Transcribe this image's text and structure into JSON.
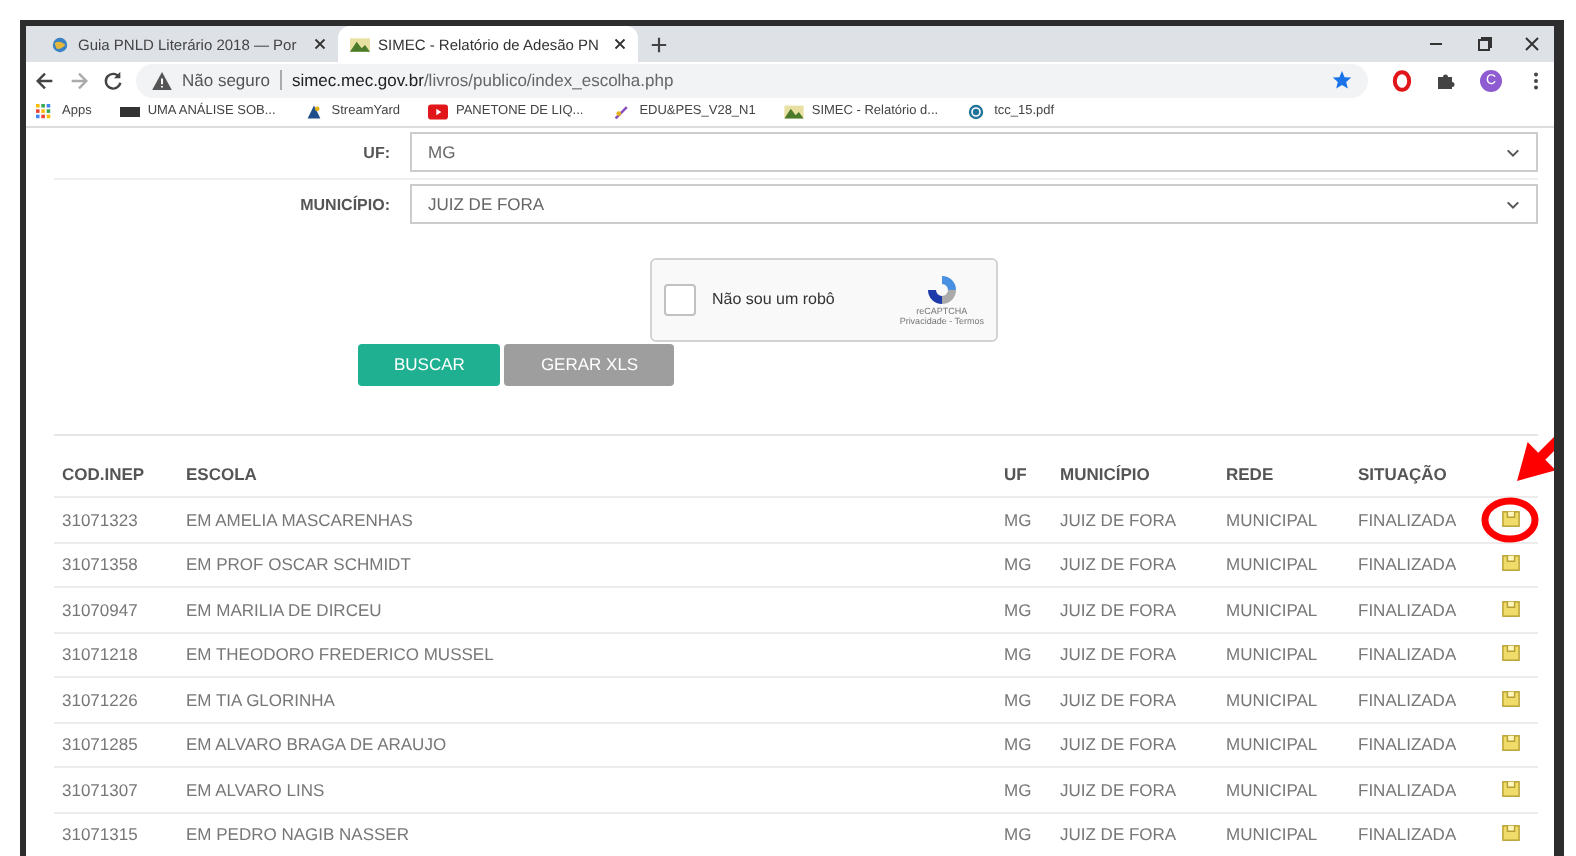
{
  "browser": {
    "tabs": [
      {
        "title": "Guia PNLD Literário 2018 — Por",
        "selected": false
      },
      {
        "title": "SIMEC - Relatório de Adesão PN",
        "selected": true
      }
    ],
    "address": {
      "security": "Não seguro",
      "host": "simec.mec.gov.br",
      "path": "/livros/publico/index_escolha.php",
      "starred": true
    },
    "profile_initial": "C",
    "bookmarks": [
      {
        "label": "Apps"
      },
      {
        "label": "UMA ANÁLISE SOB..."
      },
      {
        "label": "StreamYard"
      },
      {
        "label": "PANETONE DE LIQ..."
      },
      {
        "label": "EDU&PES_V28_N1"
      },
      {
        "label": "SIMEC - Relatório d..."
      },
      {
        "label": "tcc_15.pdf"
      }
    ]
  },
  "form": {
    "fields": [
      {
        "label": "UF:",
        "value": "MG"
      },
      {
        "label": "MUNICÍPIO:",
        "value": "JUIZ DE FORA"
      }
    ],
    "captcha": {
      "label": "Não sou um robô",
      "checked": false,
      "brand": "reCAPTCHA",
      "links": "Privacidade - Termos"
    },
    "buttons": [
      {
        "label": "BUSCAR",
        "disabled": false
      },
      {
        "label": "GERAR XLS",
        "disabled": true
      }
    ]
  },
  "table": {
    "columns": [
      "COD.INEP",
      "ESCOLA",
      "UF",
      "MUNICÍPIO",
      "REDE",
      "SITUAÇÃO"
    ],
    "rows": [
      {
        "cells": [
          "31071323",
          "EM AMELIA MASCARENHAS",
          "MG",
          "JUIZ DE FORA",
          "MUNICIPAL",
          "FINALIZADA"
        ],
        "highlighted": true
      },
      {
        "cells": [
          "31071358",
          "EM PROF OSCAR SCHMIDT",
          "MG",
          "JUIZ DE FORA",
          "MUNICIPAL",
          "FINALIZADA"
        ],
        "highlighted": false
      },
      {
        "cells": [
          "31070947",
          "EM MARILIA DE DIRCEU",
          "MG",
          "JUIZ DE FORA",
          "MUNICIPAL",
          "FINALIZADA"
        ],
        "highlighted": false
      },
      {
        "cells": [
          "31071218",
          "EM THEODORO FREDERICO MUSSEL",
          "MG",
          "JUIZ DE FORA",
          "MUNICIPAL",
          "FINALIZADA"
        ],
        "highlighted": false
      },
      {
        "cells": [
          "31071226",
          "EM TIA GLORINHA",
          "MG",
          "JUIZ DE FORA",
          "MUNICIPAL",
          "FINALIZADA"
        ],
        "highlighted": false
      },
      {
        "cells": [
          "31071285",
          "EM ALVARO BRAGA DE ARAUJO",
          "MG",
          "JUIZ DE FORA",
          "MUNICIPAL",
          "FINALIZADA"
        ],
        "highlighted": false
      },
      {
        "cells": [
          "31071307",
          "EM ALVARO LINS",
          "MG",
          "JUIZ DE FORA",
          "MUNICIPAL",
          "FINALIZADA"
        ],
        "highlighted": false
      },
      {
        "cells": [
          "31071315",
          "EM PEDRO NAGIB NASSER",
          "MG",
          "JUIZ DE FORA",
          "MUNICIPAL",
          "FINALIZADA"
        ],
        "highlighted": false
      }
    ]
  }
}
